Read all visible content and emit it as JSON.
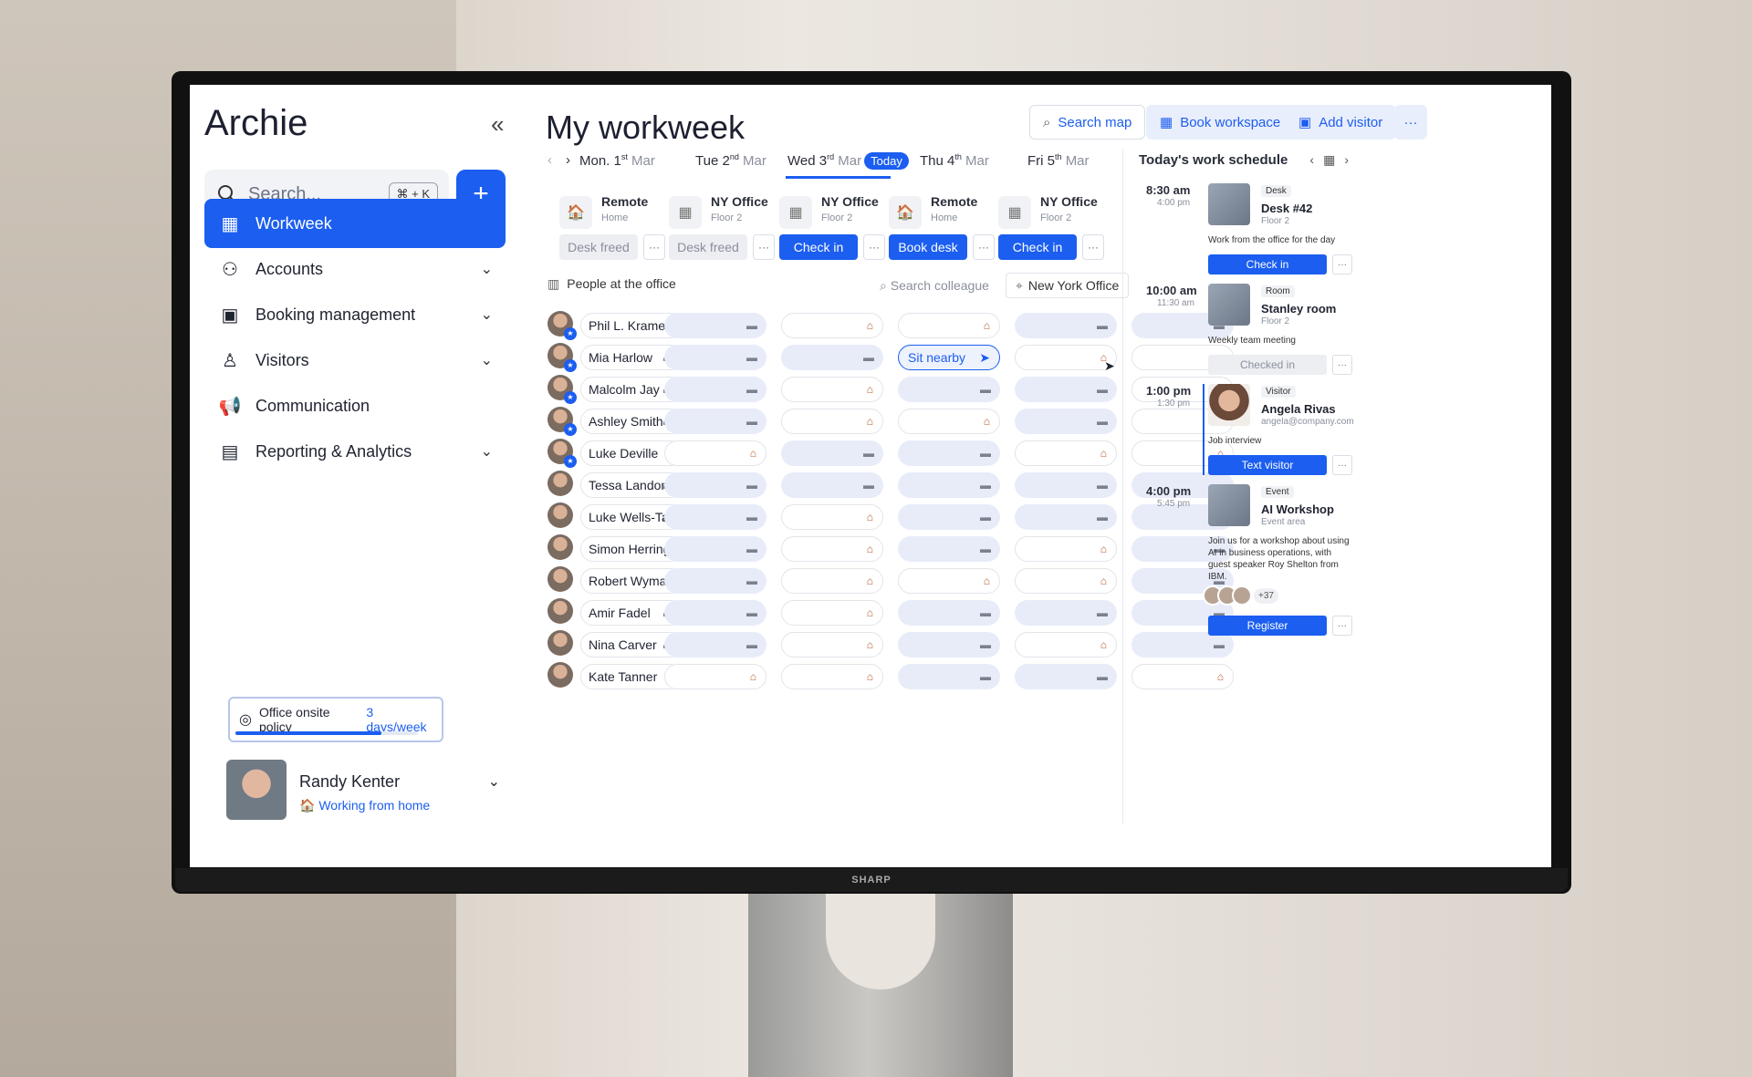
{
  "app": {
    "name": "Archie",
    "collapse_icon": "«"
  },
  "search": {
    "placeholder": "Search...",
    "shortcut": "⌘ + K",
    "add_label": "+"
  },
  "nav": [
    {
      "label": "Workweek",
      "icon": "▦",
      "chevron": ""
    },
    {
      "label": "Accounts",
      "icon": "⚇",
      "chevron": "⌄"
    },
    {
      "label": "Booking management",
      "icon": "▣",
      "chevron": "⌄"
    },
    {
      "label": "Visitors",
      "icon": "♙",
      "chevron": "⌄"
    },
    {
      "label": "Communication",
      "icon": "📢",
      "chevron": ""
    },
    {
      "label": "Reporting & Analytics",
      "icon": "▤",
      "chevron": "⌄"
    }
  ],
  "policy": {
    "icon": "◎",
    "label": "Office onsite policy",
    "value": "3 days/week",
    "progress": 0.8
  },
  "user": {
    "name": "Randy Kenter",
    "status": "Working from home",
    "status_icon": "🏠",
    "chevron": "⌄"
  },
  "header": {
    "title": "My workweek",
    "search_map": "Search map",
    "book_workspace": "Book workspace",
    "add_visitor": "Add visitor",
    "more": "···"
  },
  "days": [
    {
      "dow": "Mon. 1",
      "sup": "st",
      "month": "Mar",
      "today": ""
    },
    {
      "dow": "Tue 2",
      "sup": "nd",
      "month": "Mar",
      "today": ""
    },
    {
      "dow": "Wed 3",
      "sup": "rd",
      "month": "Mar",
      "today": "Today"
    },
    {
      "dow": "Thu 4",
      "sup": "th",
      "month": "Mar",
      "today": ""
    },
    {
      "dow": "Fri 5",
      "sup": "th",
      "month": "Mar",
      "today": ""
    }
  ],
  "day_nav": {
    "prev": "‹",
    "next": "›"
  },
  "day_cards": [
    {
      "title": "Remote",
      "sub": "Home",
      "icon": "🏠",
      "action": "Desk freed",
      "style": "gray"
    },
    {
      "title": "NY Office",
      "sub": "Floor 2",
      "icon": "▦",
      "action": "Desk freed",
      "style": "gray"
    },
    {
      "title": "NY Office",
      "sub": "Floor 2",
      "icon": "▦",
      "action": "Check in",
      "style": "blue"
    },
    {
      "title": "Remote",
      "sub": "Home",
      "icon": "🏠",
      "action": "Book desk",
      "style": "blue"
    },
    {
      "title": "NY Office",
      "sub": "Floor 2",
      "icon": "▦",
      "action": "Check in",
      "style": "blue"
    }
  ],
  "people_section": {
    "title": "People at the office",
    "search_placeholder": "Search colleague",
    "office": "New York Office"
  },
  "people": [
    {
      "name": "Phil L. Kramer",
      "star": true,
      "days": [
        "o",
        "h",
        "h",
        "o",
        "o"
      ]
    },
    {
      "name": "Mia Harlow",
      "star": true,
      "days": [
        "o",
        "o",
        "sit",
        "h",
        "h"
      ]
    },
    {
      "name": "Malcolm Jay",
      "star": true,
      "days": [
        "o",
        "h",
        "o",
        "o",
        "h"
      ]
    },
    {
      "name": "Ashley Smith",
      "star": true,
      "days": [
        "o",
        "h",
        "h",
        "o",
        "h"
      ]
    },
    {
      "name": "Luke Deville",
      "star": true,
      "days": [
        "h",
        "o",
        "o",
        "h",
        "h"
      ]
    },
    {
      "name": "Tessa Landon",
      "star": false,
      "days": [
        "o",
        "o",
        "o",
        "o",
        "o"
      ]
    },
    {
      "name": "Luke Wells-Tate",
      "star": false,
      "days": [
        "o",
        "h",
        "o",
        "o",
        "o"
      ]
    },
    {
      "name": "Simon Herring",
      "star": false,
      "days": [
        "o",
        "h",
        "o",
        "h",
        "o"
      ]
    },
    {
      "name": "Robert Wyman",
      "star": false,
      "days": [
        "o",
        "h",
        "h",
        "h",
        "o"
      ]
    },
    {
      "name": "Amir Fadel",
      "star": false,
      "days": [
        "o",
        "h",
        "o",
        "o",
        "o"
      ]
    },
    {
      "name": "Nina Carver",
      "star": false,
      "days": [
        "o",
        "h",
        "o",
        "h",
        "o"
      ]
    },
    {
      "name": "Kate Tanner",
      "star": false,
      "days": [
        "h",
        "h",
        "o",
        "o",
        "h"
      ]
    }
  ],
  "sit_nearby": {
    "label": "Sit nearby",
    "icon": "➤"
  },
  "schedule": {
    "title": "Today's work schedule",
    "events": [
      {
        "start": "8:30 am",
        "end": "4:00 pm",
        "type": "Desk",
        "name": "Desk #42",
        "sub": "Floor 2",
        "desc": "Work from the office for the day",
        "button": "Check in",
        "button_style": "blue"
      },
      {
        "start": "10:00 am",
        "end": "11:30 am",
        "type": "Room",
        "name": "Stanley room",
        "sub": "Floor 2",
        "desc": "Weekly team meeting",
        "button": "Checked in",
        "button_style": "gray"
      },
      {
        "start": "1:00 pm",
        "end": "1:30 pm",
        "type": "Visitor",
        "name": "Angela Rivas",
        "sub": "angela@company.com",
        "desc": "Job interview",
        "button": "Text visitor",
        "button_style": "blue"
      },
      {
        "start": "4:00 pm",
        "end": "5:45 pm",
        "type": "Event",
        "name": "AI Workshop",
        "sub": "Event area",
        "desc": "Join us for a workshop about using AI in business operations, with guest speaker Roy Shelton from IBM.",
        "button": "Register",
        "button_style": "blue",
        "attendees": "+37"
      }
    ]
  },
  "monitor": {
    "brand": "SHARP"
  }
}
